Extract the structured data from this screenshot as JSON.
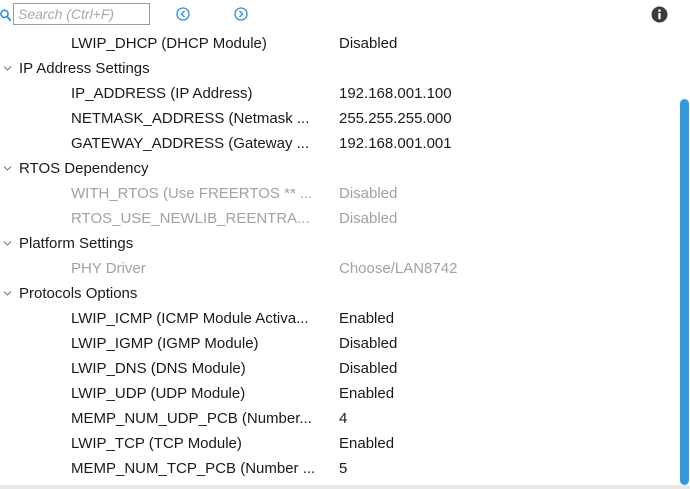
{
  "toolbar": {
    "search_placeholder": "Search (Ctrl+F)",
    "search_value": "",
    "icons": {
      "search": "search-icon",
      "prev": "circle-chevron-left-icon",
      "next": "circle-chevron-right-icon",
      "info": "info-icon"
    },
    "accent_color": "#2e8fe0"
  },
  "tree": {
    "rows": [
      {
        "kind": "param",
        "label": "LWIP_DHCP (DHCP Module)",
        "value": "Disabled",
        "enabled": true
      },
      {
        "kind": "group",
        "label": "IP Address Settings",
        "expanded": true
      },
      {
        "kind": "param",
        "label": "IP_ADDRESS (IP Address)",
        "value": "192.168.001.100",
        "enabled": true
      },
      {
        "kind": "param",
        "label": "NETMASK_ADDRESS (Netmask ...",
        "value": "255.255.255.000",
        "enabled": true
      },
      {
        "kind": "param",
        "label": "GATEWAY_ADDRESS (Gateway ...",
        "value": "192.168.001.001",
        "enabled": true
      },
      {
        "kind": "group",
        "label": "RTOS Dependency",
        "expanded": true
      },
      {
        "kind": "param",
        "label": "WITH_RTOS (Use FREERTOS ** ...",
        "value": "Disabled",
        "enabled": false
      },
      {
        "kind": "param",
        "label": "RTOS_USE_NEWLIB_REENTRA...",
        "value": "Disabled",
        "enabled": false
      },
      {
        "kind": "group",
        "label": "Platform Settings",
        "expanded": true
      },
      {
        "kind": "param",
        "label": "PHY Driver",
        "value": "Choose/LAN8742",
        "enabled": false
      },
      {
        "kind": "group",
        "label": "Protocols Options",
        "expanded": true
      },
      {
        "kind": "param",
        "label": "LWIP_ICMP (ICMP Module Activa...",
        "value": "Enabled",
        "enabled": true
      },
      {
        "kind": "param",
        "label": "LWIP_IGMP (IGMP Module)",
        "value": "Disabled",
        "enabled": true
      },
      {
        "kind": "param",
        "label": "LWIP_DNS (DNS Module)",
        "value": "Disabled",
        "enabled": true
      },
      {
        "kind": "param",
        "label": "LWIP_UDP (UDP Module)",
        "value": "Enabled",
        "enabled": true
      },
      {
        "kind": "param",
        "label": "MEMP_NUM_UDP_PCB (Number...",
        "value": "4",
        "enabled": true
      },
      {
        "kind": "param",
        "label": "LWIP_TCP (TCP Module)",
        "value": "Enabled",
        "enabled": true
      },
      {
        "kind": "param",
        "label": "MEMP_NUM_TCP_PCB (Number ...",
        "value": "5",
        "enabled": true
      }
    ],
    "text_color": "#1a1a1a",
    "disabled_color": "#a2a2a2"
  },
  "scrollbar": {
    "thumb_color": "#3399dd"
  }
}
